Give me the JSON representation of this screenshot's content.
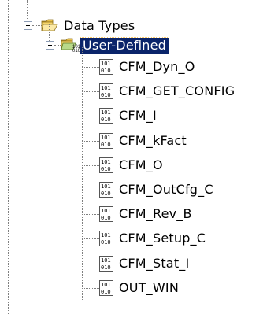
{
  "tree": {
    "folder": {
      "label": "Data Types",
      "expanded": true,
      "icon": "folder-open-icon"
    },
    "subfolder": {
      "label": "User-Defined",
      "expanded": true,
      "selected": true,
      "icon": "user-defined-folder-icon"
    },
    "items": [
      {
        "label": "CFM_Dyn_O",
        "icon": "binary-datatype-icon"
      },
      {
        "label": "CFM_GET_CONFIG",
        "icon": "binary-datatype-icon"
      },
      {
        "label": "CFM_I",
        "icon": "binary-datatype-icon"
      },
      {
        "label": "CFM_kFact",
        "icon": "binary-datatype-icon"
      },
      {
        "label": "CFM_O",
        "icon": "binary-datatype-icon"
      },
      {
        "label": "CFM_OutCfg_C",
        "icon": "binary-datatype-icon"
      },
      {
        "label": "CFM_Rev_B",
        "icon": "binary-datatype-icon"
      },
      {
        "label": "CFM_Setup_C",
        "icon": "binary-datatype-icon"
      },
      {
        "label": "CFM_Stat_I",
        "icon": "binary-datatype-icon"
      },
      {
        "label": "OUT_WIN",
        "icon": "binary-datatype-icon"
      }
    ],
    "colors": {
      "selection_bg": "#0a246a",
      "selection_text": "#ffffff",
      "folder_yellow": "#f6d66a",
      "folder_green": "#5a9a3a"
    }
  }
}
